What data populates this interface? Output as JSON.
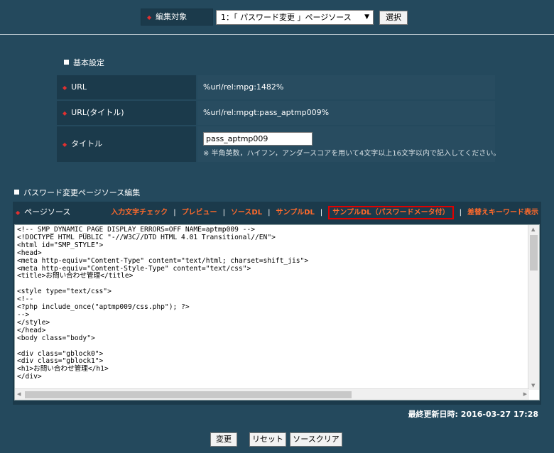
{
  "top": {
    "target_label": "編集対象",
    "target_selected": "1：「 パスワード変更 」ページソース",
    "select_button": "選択"
  },
  "basic": {
    "heading": "基本設定",
    "url_label": "URL",
    "url_value": "%url/rel:mpg:1482%",
    "url_title_label": "URL(タイトル)",
    "url_title_value": "%url/rel:mpgt:pass_aptmp009%",
    "title_label": "タイトル",
    "title_value": "pass_aptmp009",
    "title_note": "※ 半角英数，ハイフン，アンダースコアを用いて4文字以上16文字以内で記入してください。"
  },
  "source": {
    "heading": "パスワード変更ページソース編集",
    "toolbar_title": "ページソース",
    "links": [
      "入力文字チェック",
      "プレビュー",
      "ソースDL",
      "サンプルDL",
      "サンプルDL（パスワードメータ付）",
      "差替えキーワード表示"
    ],
    "code": "<!-- SMP_DYNAMIC_PAGE DISPLAY_ERRORS=OFF NAME=aptmp009 -->\n<!DOCTYPE HTML PUBLIC \"-//W3C//DTD HTML 4.01 Transitional//EN\">\n<html id=\"SMP_STYLE\">\n<head>\n<meta http-equiv=\"Content-Type\" content=\"text/html; charset=shift_jis\">\n<meta http-equiv=\"Content-Style-Type\" content=\"text/css\">\n<title>お問い合わせ管理</title>\n\n<style type=\"text/css\">\n<!--\n<?php include_once(\"aptmp009/css.php\"); ?>\n-->\n</style>\n</head>\n<body class=\"body\">\n\n<div class=\"gblock0\">\n<div class=\"gblock1\">\n<h1>お問い合わせ管理</h1>\n</div>",
    "last_updated": "最終更新日時: 2016-03-27 17:28"
  },
  "buttons": {
    "change": "変更",
    "reset": "リセット",
    "clear": "ソースクリア"
  },
  "colors": {
    "background": "#24495d",
    "label_cell": "#1b3a4b",
    "link_orange": "#ff6a2b",
    "highlight_red": "#e00000"
  }
}
